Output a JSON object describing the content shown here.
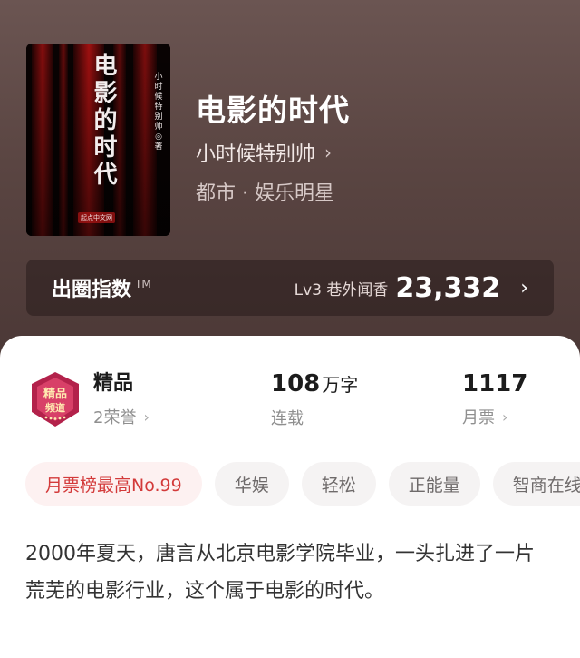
{
  "book": {
    "title": "电影的时代",
    "author": "小时候特别帅",
    "genre": "都市 · 娱乐明星",
    "cover": {
      "title_chars": [
        "电",
        "影",
        "的",
        "时",
        "代"
      ],
      "author_vertical": "小时候特别帅",
      "author_mark": "◎ 著",
      "publisher": "起点中文网",
      "color_bg": "#0a0303",
      "color_streak": "#c41414"
    }
  },
  "index": {
    "label": "出圈指数",
    "tm": "TM",
    "level": "Lv3 巷外闻香",
    "value": "23,332"
  },
  "badge": {
    "text_line1": "精品",
    "text_line2": "频道",
    "color_primary": "#b3224b"
  },
  "stats": {
    "quality": {
      "title": "精品",
      "sub": "2荣誉"
    },
    "words": {
      "value": "108",
      "unit": "万字",
      "sub": "连载"
    },
    "tickets": {
      "value": "1117",
      "sub": "月票"
    }
  },
  "tags": [
    "月票榜最高No.99",
    "华娱",
    "轻松",
    "正能量",
    "智商在线"
  ],
  "description": "2000年夏天，唐言从北京电影学院毕业，一头扎进了一片荒芜的电影行业，这个属于电影的时代。",
  "colors": {
    "hero_bg": "#5a4542",
    "accent_red": "#d33a3a",
    "tag_bg": "#f5f3f3"
  }
}
